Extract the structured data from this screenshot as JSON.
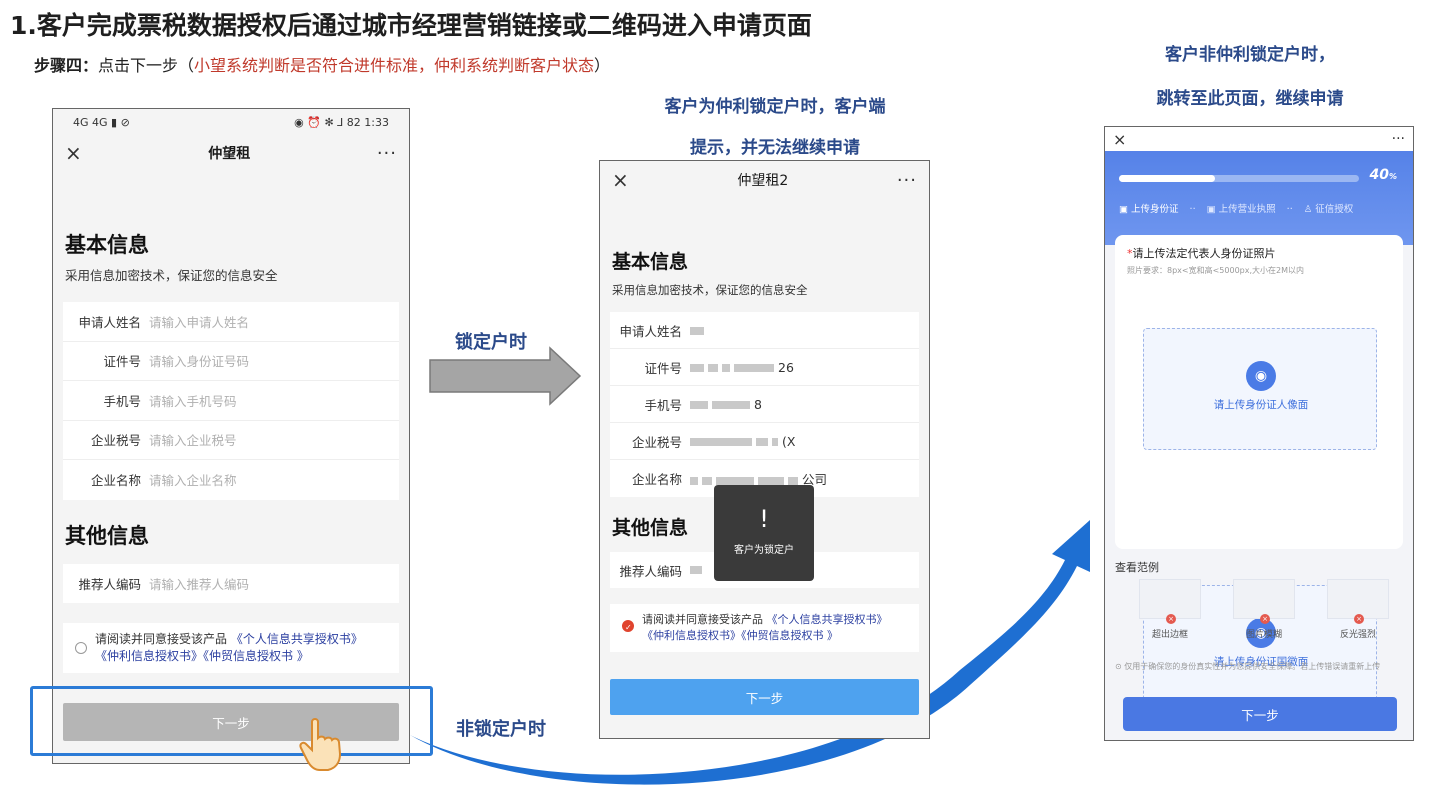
{
  "header": {
    "title": "1.客户完成票税数据授权后通过城市经理营销链接或二维码进入申请页面",
    "step_prefix": "步骤四：",
    "step_text": "点击下一步（",
    "step_red": "小望系统判断是否符合进件标准，仲利系统判断客户状态",
    "step_close": "）"
  },
  "captions": {
    "locked_top_line1": "客户为仲利锁定户时，客户端",
    "locked_top_line2": "提示，并无法继续申请",
    "not_locked_right_line1": "客户非仲利锁定户时，",
    "not_locked_right_line2": "跳转至此页面，继续申请",
    "arrow_locked": "锁定户时",
    "arrow_not_locked": "非锁定户时"
  },
  "phone1": {
    "status_left": "4G 4G ▮ ⊘",
    "status_right": "◉ ⏰ ✻ ⅃ 82 1:33",
    "nav_title": "仲望租",
    "close_glyph": "×",
    "more_glyph": "···",
    "basic_title": "基本信息",
    "basic_sub": "采用信息加密技术，保证您的信息安全",
    "fields": [
      {
        "label": "申请人姓名",
        "placeholder": "请输入申请人姓名"
      },
      {
        "label": "证件号",
        "placeholder": "请输入身份证号码"
      },
      {
        "label": "手机号",
        "placeholder": "请输入手机号码"
      },
      {
        "label": "企业税号",
        "placeholder": "请输入企业税号"
      },
      {
        "label": "企业名称",
        "placeholder": "请输入企业名称"
      }
    ],
    "other_title": "其他信息",
    "referrer": {
      "label": "推荐人编码",
      "placeholder": "请输入推荐人编码"
    },
    "agree_text": "请阅读并同意接受该产品",
    "agree_link1": "《个人信息共享授权书》",
    "agree_link2": "《仲利信息授权书》《仲贸信息授权书 》",
    "next_label": "下一步"
  },
  "phone2": {
    "nav_title": "仲望租2",
    "close_glyph": "×",
    "more_glyph": "···",
    "basic_title": "基本信息",
    "basic_sub": "采用信息加密技术，保证您的信息安全",
    "fields": [
      {
        "label": "申请人姓名",
        "suffix": ""
      },
      {
        "label": "证件号",
        "suffix": "26"
      },
      {
        "label": "手机号",
        "suffix": "8"
      },
      {
        "label": "企业税号",
        "suffix": "(X"
      },
      {
        "label": "企业名称",
        "suffix": "公司"
      }
    ],
    "other_title": "其他信息",
    "referrer_label": "推荐人编码",
    "agree_text": "请阅读并同意接受该产品",
    "agree_link1": "《个人信息共享授权书》",
    "agree_link2": "《仲利信息授权书》《仲贸信息授权书 》",
    "next_label": "下一步",
    "toast_icon": "!",
    "toast_text": "客户为锁定户"
  },
  "phone3": {
    "close_glyph": "×",
    "more_glyph": "···",
    "progress_value": 0.4,
    "progress_label": "40",
    "progress_unit": "%",
    "steps": [
      "上传身份证",
      "上传营业执照",
      "征信授权"
    ],
    "step_sep": "··",
    "upload_title_star": "*",
    "upload_title": "请上传法定代表人身份证照片",
    "upload_req": "照片要求：8px<宽和高<5000px,大小在2M以内",
    "box1_label": "请上传身份证人像面",
    "box2_label": "请上传身份证国徽面",
    "examples_title": "查看范例",
    "examples": [
      "超出边框",
      "图片模糊",
      "反光强烈"
    ],
    "notice": "仅用于确保您的身份真实性并为您提供安全保障。若上传错误请重新上传",
    "next_label": "下一步"
  },
  "colors": {
    "caption_blue": "#2b4a8a",
    "step_red": "#c0392b",
    "disabled_btn": "#b5b5b5",
    "active_btn": "#4ea2ef",
    "p3_btn": "#4a78e3",
    "highlight_box": "#2b7bd6",
    "swoosh_blue": "#1e6fd2"
  }
}
